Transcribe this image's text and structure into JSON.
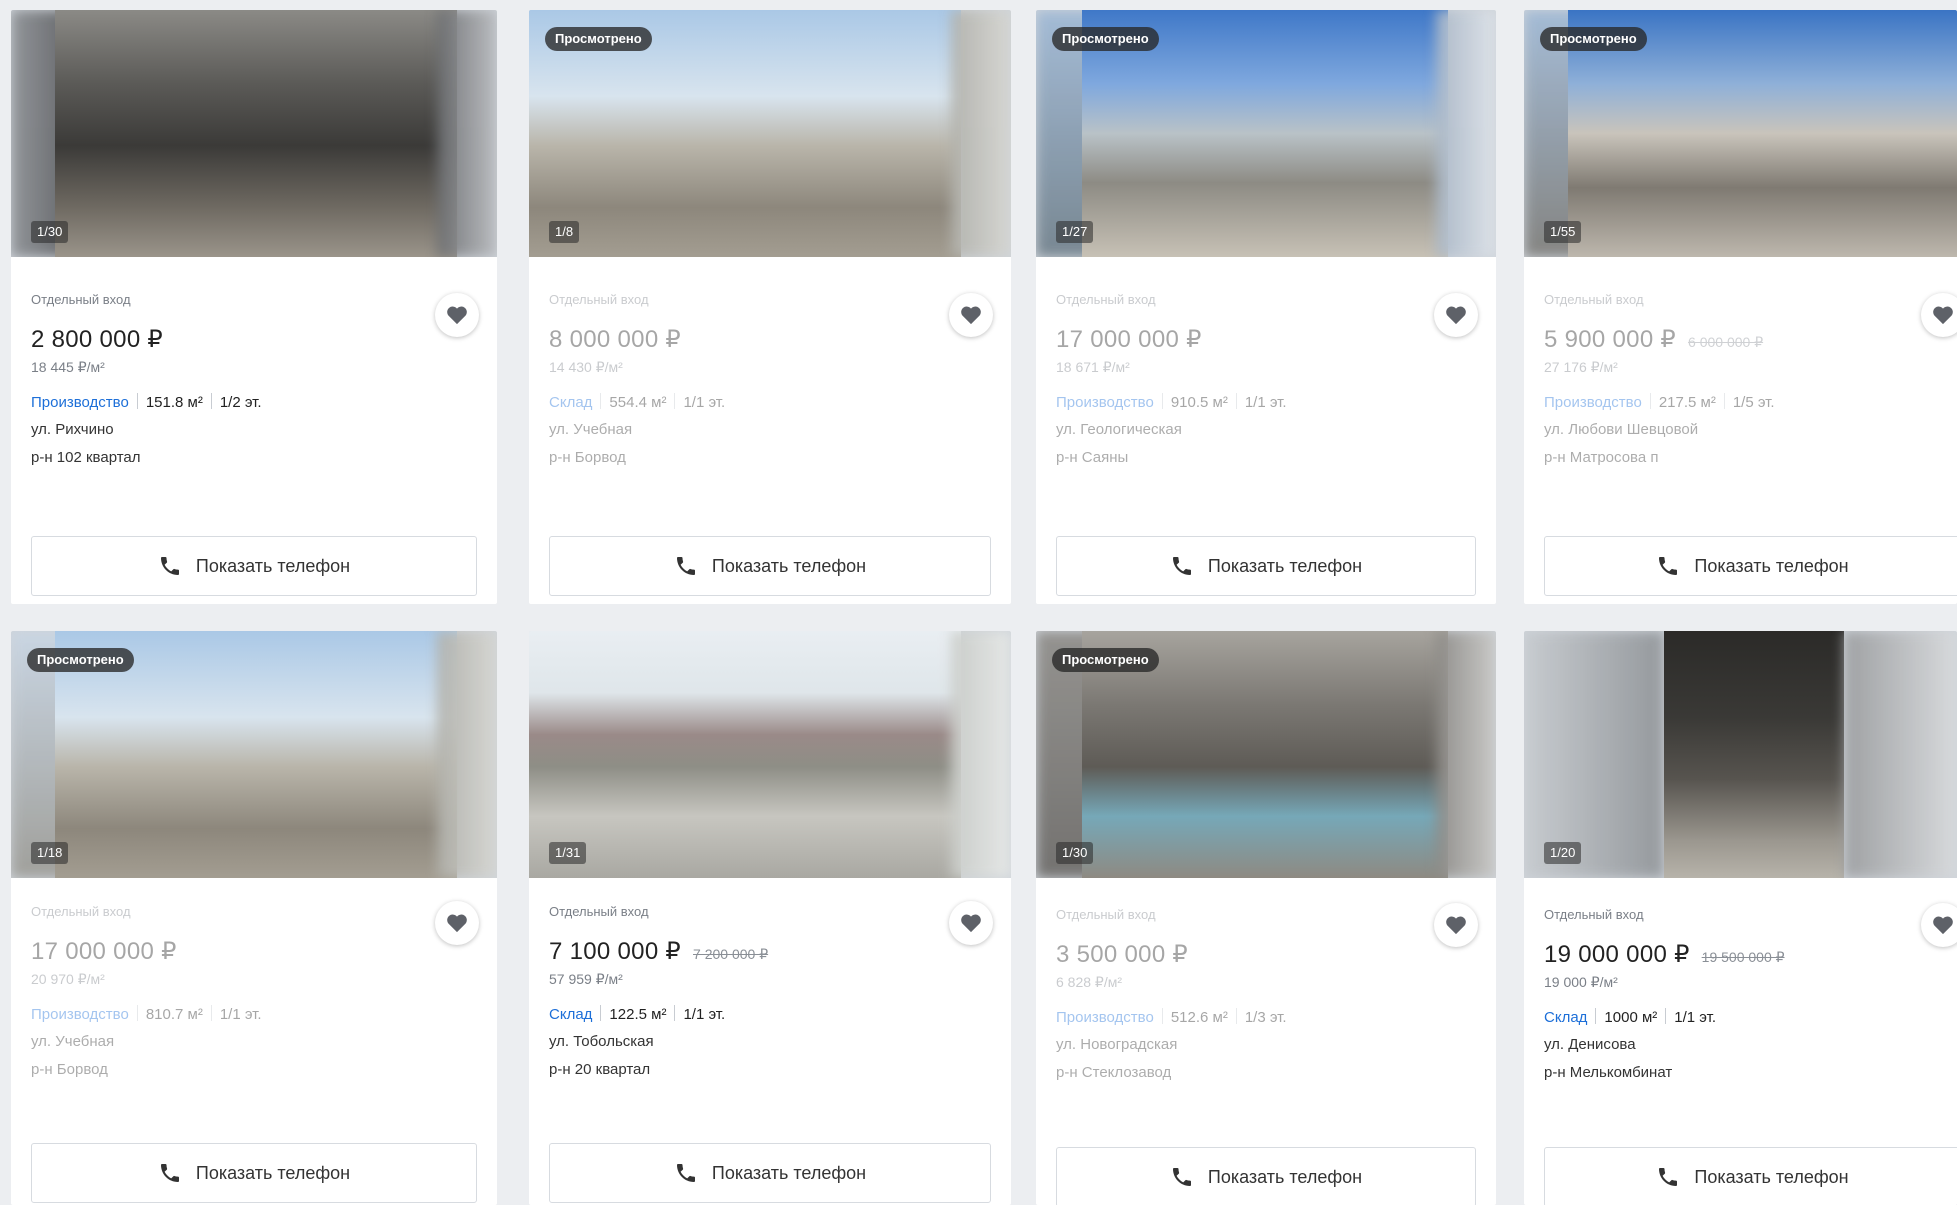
{
  "badges": {
    "viewed": "Просмотрено"
  },
  "actions": {
    "show_phone": "Показать телефон"
  },
  "icons": {
    "favorite": "heart-icon",
    "phone": "phone-icon"
  },
  "colors": {
    "accent_link": "#1d6fd8",
    "badge_bg": "#2a2a2a",
    "card_bg": "#ffffff",
    "page_bg": "#eceef1"
  },
  "listings": [
    {
      "counter": "1/30",
      "tag": "Отдельный вход",
      "price": "2 800 000 ₽",
      "old_price": "",
      "price_per_m2": "18 445 ₽/м²",
      "type": "Производство",
      "area": "151.8 м²",
      "floor": "1/2 эт.",
      "street": "ул. Рихчино",
      "district": "р-н 102 квартал"
    },
    {
      "counter": "1/8",
      "tag": "Отдельный вход",
      "price": "8 000 000 ₽",
      "old_price": "",
      "price_per_m2": "14 430 ₽/м²",
      "type": "Склад",
      "area": "554.4 м²",
      "floor": "1/1 эт.",
      "street": "ул. Учебная",
      "district": "р-н Борвод"
    },
    {
      "counter": "1/27",
      "tag": "Отдельный вход",
      "price": "17 000 000 ₽",
      "old_price": "",
      "price_per_m2": "18 671 ₽/м²",
      "type": "Производство",
      "area": "910.5 м²",
      "floor": "1/1 эт.",
      "street": "ул. Геологическая",
      "district": "р-н Саяны"
    },
    {
      "counter": "1/55",
      "tag": "Отдельный вход",
      "price": "5 900 000 ₽",
      "old_price": "6 000 000 ₽",
      "price_per_m2": "27 176 ₽/м²",
      "type": "Производство",
      "area": "217.5 м²",
      "floor": "1/5 эт.",
      "street": "ул. Любови Шевцовой",
      "district": "р-н Матросова п"
    },
    {
      "counter": "1/18",
      "tag": "Отдельный вход",
      "price": "17 000 000 ₽",
      "old_price": "",
      "price_per_m2": "20 970 ₽/м²",
      "type": "Производство",
      "area": "810.7 м²",
      "floor": "1/1 эт.",
      "street": "ул. Учебная",
      "district": "р-н Борвод"
    },
    {
      "counter": "1/31",
      "tag": "Отдельный вход",
      "price": "7 100 000 ₽",
      "old_price": "7 200 000 ₽",
      "price_per_m2": "57 959 ₽/м²",
      "type": "Склад",
      "area": "122.5 м²",
      "floor": "1/1 эт.",
      "street": "ул. Тобольская",
      "district": "р-н 20 квартал"
    },
    {
      "counter": "1/30",
      "tag": "Отдельный вход",
      "price": "3 500 000 ₽",
      "old_price": "",
      "price_per_m2": "6 828 ₽/м²",
      "type": "Производство",
      "area": "512.6 м²",
      "floor": "1/3 эт.",
      "street": "ул. Новоградская",
      "district": "р-н Стеклозавод"
    },
    {
      "counter": "1/20",
      "tag": "Отдельный вход",
      "price": "19 000 000 ₽",
      "old_price": "19 500 000 ₽",
      "price_per_m2": "19 000 ₽/м²",
      "type": "Склад",
      "area": "1000 м²",
      "floor": "1/1 эт.",
      "street": "ул. Денисова",
      "district": "р-н Мелькомбинат"
    }
  ]
}
